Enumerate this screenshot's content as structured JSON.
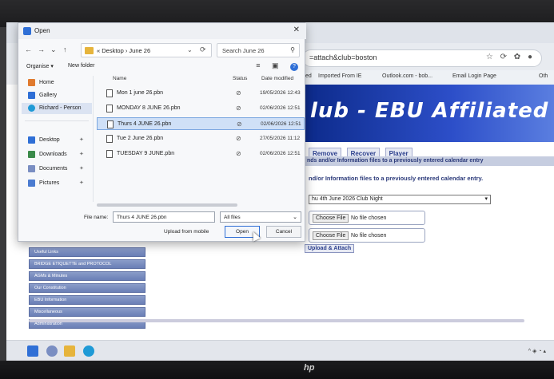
{
  "dialog": {
    "title": "Open",
    "path": "« Desktop › June 26",
    "search_placeholder": "Search June 26",
    "organise": "Organise ▾",
    "new_folder": "New folder",
    "nav": [
      {
        "label": "Home"
      },
      {
        "label": "Gallery"
      },
      {
        "label": "Richard - Person"
      },
      {
        "label": "Desktop"
      },
      {
        "label": "Downloads"
      },
      {
        "label": "Documents"
      },
      {
        "label": "Pictures"
      }
    ],
    "columns": {
      "name": "Name",
      "status": "Status",
      "date": "Date modified"
    },
    "files": [
      {
        "name": "Mon 1 june 26.pbn",
        "status": "⊘",
        "date": "19/05/2026 12:43"
      },
      {
        "name": "MONDAY 8 JUNE 26.pbn",
        "status": "⊘",
        "date": "02/06/2026 12:51"
      },
      {
        "name": "Thurs 4 JUNE 26.pbn",
        "status": "⊘",
        "date": "02/06/2026 12:51"
      },
      {
        "name": "Tue 2 June 26.pbn",
        "status": "⊘",
        "date": "27/05/2026 11:12"
      },
      {
        "name": "TUESDAY 9 JUNE.pbn",
        "status": "⊘",
        "date": "02/06/2026 12:51"
      }
    ],
    "filename_label": "File name:",
    "filename_value": "Thurs 4 JUNE 26.pbn",
    "filetype": "All files",
    "upload_mobile": "Upload from mobile",
    "open_label": "Open",
    "cancel_label": "Cancel"
  },
  "browser": {
    "url": "=attach&club=boston",
    "bookmarks": [
      "ted",
      "Imported From IE",
      "Outlook.com - bob...",
      "Email Login Page",
      "Oth"
    ],
    "banner": "lub  -  EBU Affiliated",
    "tabs": [
      "Remove",
      "Recover",
      "Player"
    ],
    "info_bar": "nds and/or Information files to a previously entered calendar entry",
    "info_line": "nd/or Information files to a previously entered calendar entry.",
    "event_select": "hu 4th June 2026 Club Night",
    "choose_file": "Choose File",
    "no_file": "No file chosen",
    "upload_attach": "Upload & Attach",
    "menu": [
      "Useful Links",
      "BRIDGE ETIQUETTE and PROTOCOL",
      "AGMs & Minutes",
      "Our Constitution",
      "EBU Information",
      "Miscellaneous",
      "Administration"
    ]
  },
  "colors": {
    "accent": "#2f6fd6",
    "banner": "#1a3aa8",
    "menu": "#7a8ec2"
  }
}
